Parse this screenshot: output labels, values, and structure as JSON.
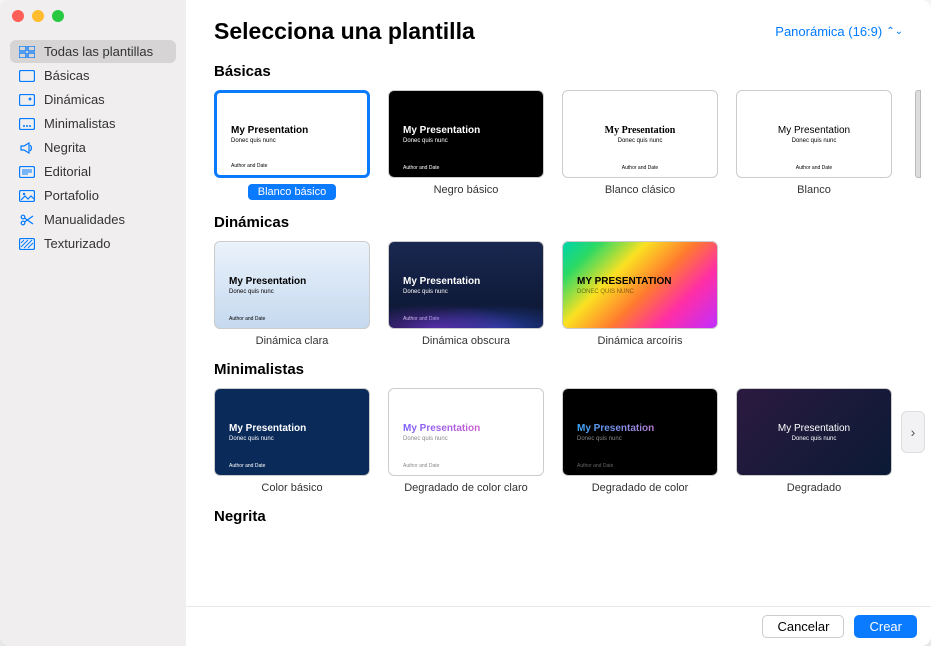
{
  "header": {
    "title": "Selecciona una plantilla",
    "aspect_label": "Panorámica (16:9)"
  },
  "sidebar": {
    "items": [
      {
        "label": "Todas las plantillas"
      },
      {
        "label": "Básicas"
      },
      {
        "label": "Dinámicas"
      },
      {
        "label": "Minimalistas"
      },
      {
        "label": "Negrita"
      },
      {
        "label": "Editorial"
      },
      {
        "label": "Portafolio"
      },
      {
        "label": "Manualidades"
      },
      {
        "label": "Texturizado"
      }
    ]
  },
  "thumb": {
    "title": "My Presentation",
    "sub": "Donec quis nunc",
    "sub2": "DONEC QUIS NUNC",
    "auth": "Author and Date"
  },
  "sections": [
    {
      "title": "Básicas",
      "templates": [
        "Blanco básico",
        "Negro básico",
        "Blanco clásico",
        "Blanco"
      ]
    },
    {
      "title": "Dinámicas",
      "templates": [
        "Dinámica clara",
        "Dinámica obscura",
        "Dinámica arcoíris"
      ]
    },
    {
      "title": "Minimalistas",
      "templates": [
        "Color básico",
        "Degradado de color claro",
        "Degradado de color",
        "Degradado"
      ]
    },
    {
      "title": "Negrita",
      "templates": []
    }
  ],
  "footer": {
    "cancel": "Cancelar",
    "create": "Crear"
  },
  "colors": {
    "accent": "#007aff",
    "selection": "#0a7aff"
  }
}
